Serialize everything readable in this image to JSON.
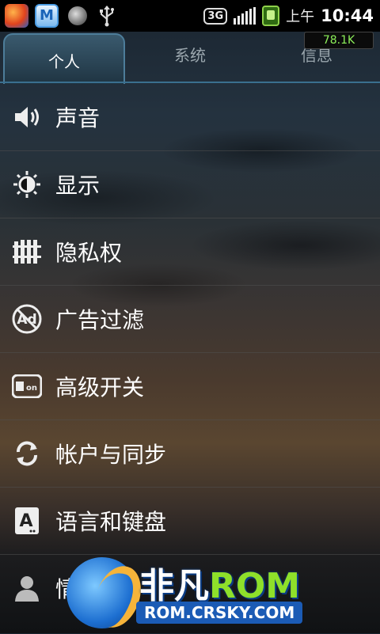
{
  "statusbar": {
    "network": "3G",
    "ampm": "上午",
    "time": "10:44",
    "net_speed": "78.1K"
  },
  "tabs": [
    {
      "label": "个人",
      "active": true
    },
    {
      "label": "系统",
      "active": false
    },
    {
      "label": "信息",
      "active": false
    }
  ],
  "items": [
    {
      "label": "声音",
      "icon": "speaker-icon"
    },
    {
      "label": "显示",
      "icon": "brightness-icon"
    },
    {
      "label": "隐私权",
      "icon": "fence-icon"
    },
    {
      "label": "广告过滤",
      "icon": "ad-block-icon"
    },
    {
      "label": "高级开关",
      "icon": "toggle-on-icon"
    },
    {
      "label": "帐户与同步",
      "icon": "sync-icon"
    },
    {
      "label": "语言和键盘",
      "icon": "keyboard-a-icon"
    },
    {
      "label": "情景",
      "icon": "person-icon"
    }
  ],
  "watermark": {
    "title_a": "非凡",
    "title_b": "ROM",
    "url": "ROM.CRSKY.COM"
  },
  "colors": {
    "accent": "#4d7d9a",
    "speed_text": "#8df05a",
    "battery": "#8fd14a"
  }
}
